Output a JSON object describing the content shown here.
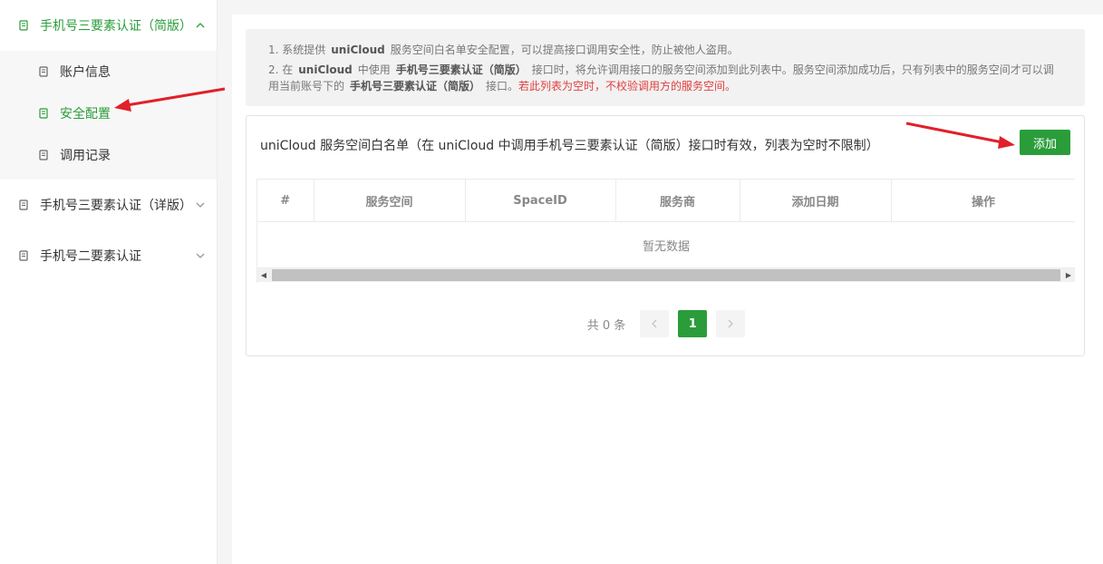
{
  "sidebar": {
    "groups": [
      {
        "label": "手机号三要素认证（简版）",
        "expanded": true,
        "items": [
          {
            "label": "账户信息"
          },
          {
            "label": "安全配置"
          },
          {
            "label": "调用记录"
          }
        ]
      },
      {
        "label": "手机号三要素认证（详版）"
      },
      {
        "label": "手机号二要素认证"
      }
    ]
  },
  "notice": {
    "line1_prefix": "1. 系统提供",
    "line1_bold": "uniCloud",
    "line1_suffix": "服务空间白名单安全配置，可以提高接口调用安全性，防止被他人盗用。",
    "line2_a": "2. 在",
    "line2_b": "uniCloud",
    "line2_c": "中使用",
    "line2_d": "手机号三要素认证（简版）",
    "line2_e": "接口时，将允许调用接口的服务空间添加到此列表中。服务空间添加成功后，只有列表中的服务空间才可以调用当前账号下的",
    "line2_f": "手机号三要素认证（简版）",
    "line2_g": "接口。",
    "line2_warn": "若此列表为空时，不校验调用方的服务空间。"
  },
  "panel": {
    "title": "uniCloud 服务空间白名单（在 uniCloud 中调用手机号三要素认证（简版）接口时有效，列表为空时不限制）",
    "add_label": "添加"
  },
  "table": {
    "columns": [
      "#",
      "服务空间",
      "SpaceID",
      "服务商",
      "添加日期",
      "操作"
    ],
    "empty_text": "暂无数据"
  },
  "pagination": {
    "total_text": "共 0 条",
    "current_page": "1"
  },
  "colors": {
    "accent": "#2a9d3a",
    "warning": "#e03e3e"
  }
}
